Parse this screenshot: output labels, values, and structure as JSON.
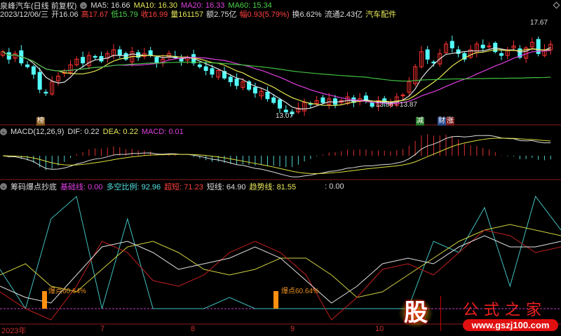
{
  "header": {
    "title": "泉峰汽车(日线 前复权)",
    "ma5": "MA5: 16.66",
    "ma10": "MA10: 16.30",
    "ma20": "MA20: 16.33",
    "ma60": "MA60: 15.34"
  },
  "quote": {
    "date": "2023/12/06/三",
    "open": "开16.06",
    "high": "高17.67",
    "low": "低15.79",
    "close": "收16.99",
    "volume": "量161157",
    "amount": "额2.75亿",
    "change": "幅0.93(5.79%)",
    "turnover": "换6.62%",
    "float": "流通2.43亿",
    "sector": "汽车配件"
  },
  "annotations": {
    "max": "17.67",
    "min": "13.07",
    "range": "13.86 - 13.87",
    "tag_bang": "榜",
    "tag_jian": "减",
    "tag_cai": "财",
    "tag_zhang": "涨"
  },
  "macd": {
    "title": "MACD(12,26,9)",
    "dif": "DIF: 0.22",
    "dea": "DEA: 0.22",
    "macd": "MACD: 0.01"
  },
  "indicator": {
    "title": "筹码爆点抄底",
    "base": "基础线: 0.00",
    "ratio": "多空比例: 92.96",
    "ultra": "超短: 71.23",
    "short": "短线: 64.90",
    "trend": "趋势线: 81.55",
    "extra": ": 0.00",
    "blast1": "爆点60.64%",
    "blast2": "爆点60.64%"
  },
  "xaxis": {
    "labels": [
      "2023年",
      "7",
      "8",
      "9",
      "10"
    ]
  },
  "watermark": {
    "char": "股",
    "name": "公式之家",
    "url": "www.gszj100.com"
  },
  "colors": {
    "up": "#ff3232",
    "down": "#54ffff",
    "ma5": "#e0e0e0",
    "ma10": "#e8e850",
    "ma20": "#e040e0",
    "ma60": "#40c040"
  },
  "chart_data": {
    "type": "candlestick",
    "closes": [
      16.6,
      16.2,
      16.5,
      16.0,
      15.8,
      15.4,
      14.6,
      14.4,
      15.0,
      15.3,
      15.6,
      15.9,
      16.2,
      16.0,
      16.4,
      16.3,
      16.1,
      16.5,
      16.7,
      16.4,
      16.2,
      16.6,
      16.3,
      16.5,
      16.4,
      16.0,
      16.2,
      16.5,
      16.3,
      16.1,
      16.3,
      16.0,
      15.8,
      15.6,
      15.4,
      15.6,
      15.2,
      15.0,
      14.8,
      15.0,
      14.6,
      14.4,
      14.5,
      14.1,
      13.9,
      13.6,
      13.4,
      13.3,
      13.6,
      13.9,
      13.8,
      14.0,
      13.9,
      14.1,
      13.8,
      14.0,
      14.2,
      13.9,
      14.1,
      14.0,
      13.7,
      14.0,
      13.9,
      13.8,
      14.2,
      14.3,
      15.0,
      15.8,
      16.6,
      16.2,
      16.0,
      16.5,
      17.0,
      16.8,
      16.5,
      16.2,
      16.7,
      17.0,
      16.8,
      16.9,
      16.6,
      16.4,
      16.7,
      16.9,
      16.3,
      16.8,
      17.1,
      16.5,
      16.7,
      16.99
    ],
    "price_range": [
      12.9,
      18.3
    ],
    "indicator_series": {
      "short": [
        20,
        10,
        5,
        30,
        55,
        60,
        50,
        35,
        40,
        45,
        55,
        45,
        25,
        5,
        20,
        40,
        45,
        40,
        55,
        65,
        55,
        55,
        60
      ],
      "ultra": [
        15,
        0,
        -10,
        20,
        60,
        50,
        25,
        20,
        30,
        50,
        60,
        50,
        30,
        -10,
        10,
        35,
        40,
        30,
        50,
        70,
        65,
        50,
        55
      ],
      "trend": [
        30,
        40,
        20,
        15,
        35,
        55,
        60,
        50,
        35,
        30,
        35,
        45,
        45,
        30,
        10,
        15,
        30,
        45,
        60,
        70,
        75,
        70,
        65
      ],
      "ratio": [
        35,
        0,
        80,
        100,
        0,
        80,
        0,
        0,
        0,
        10,
        0,
        0,
        0,
        0,
        0,
        0,
        0,
        60,
        50,
        90,
        20,
        100,
        70
      ]
    }
  }
}
